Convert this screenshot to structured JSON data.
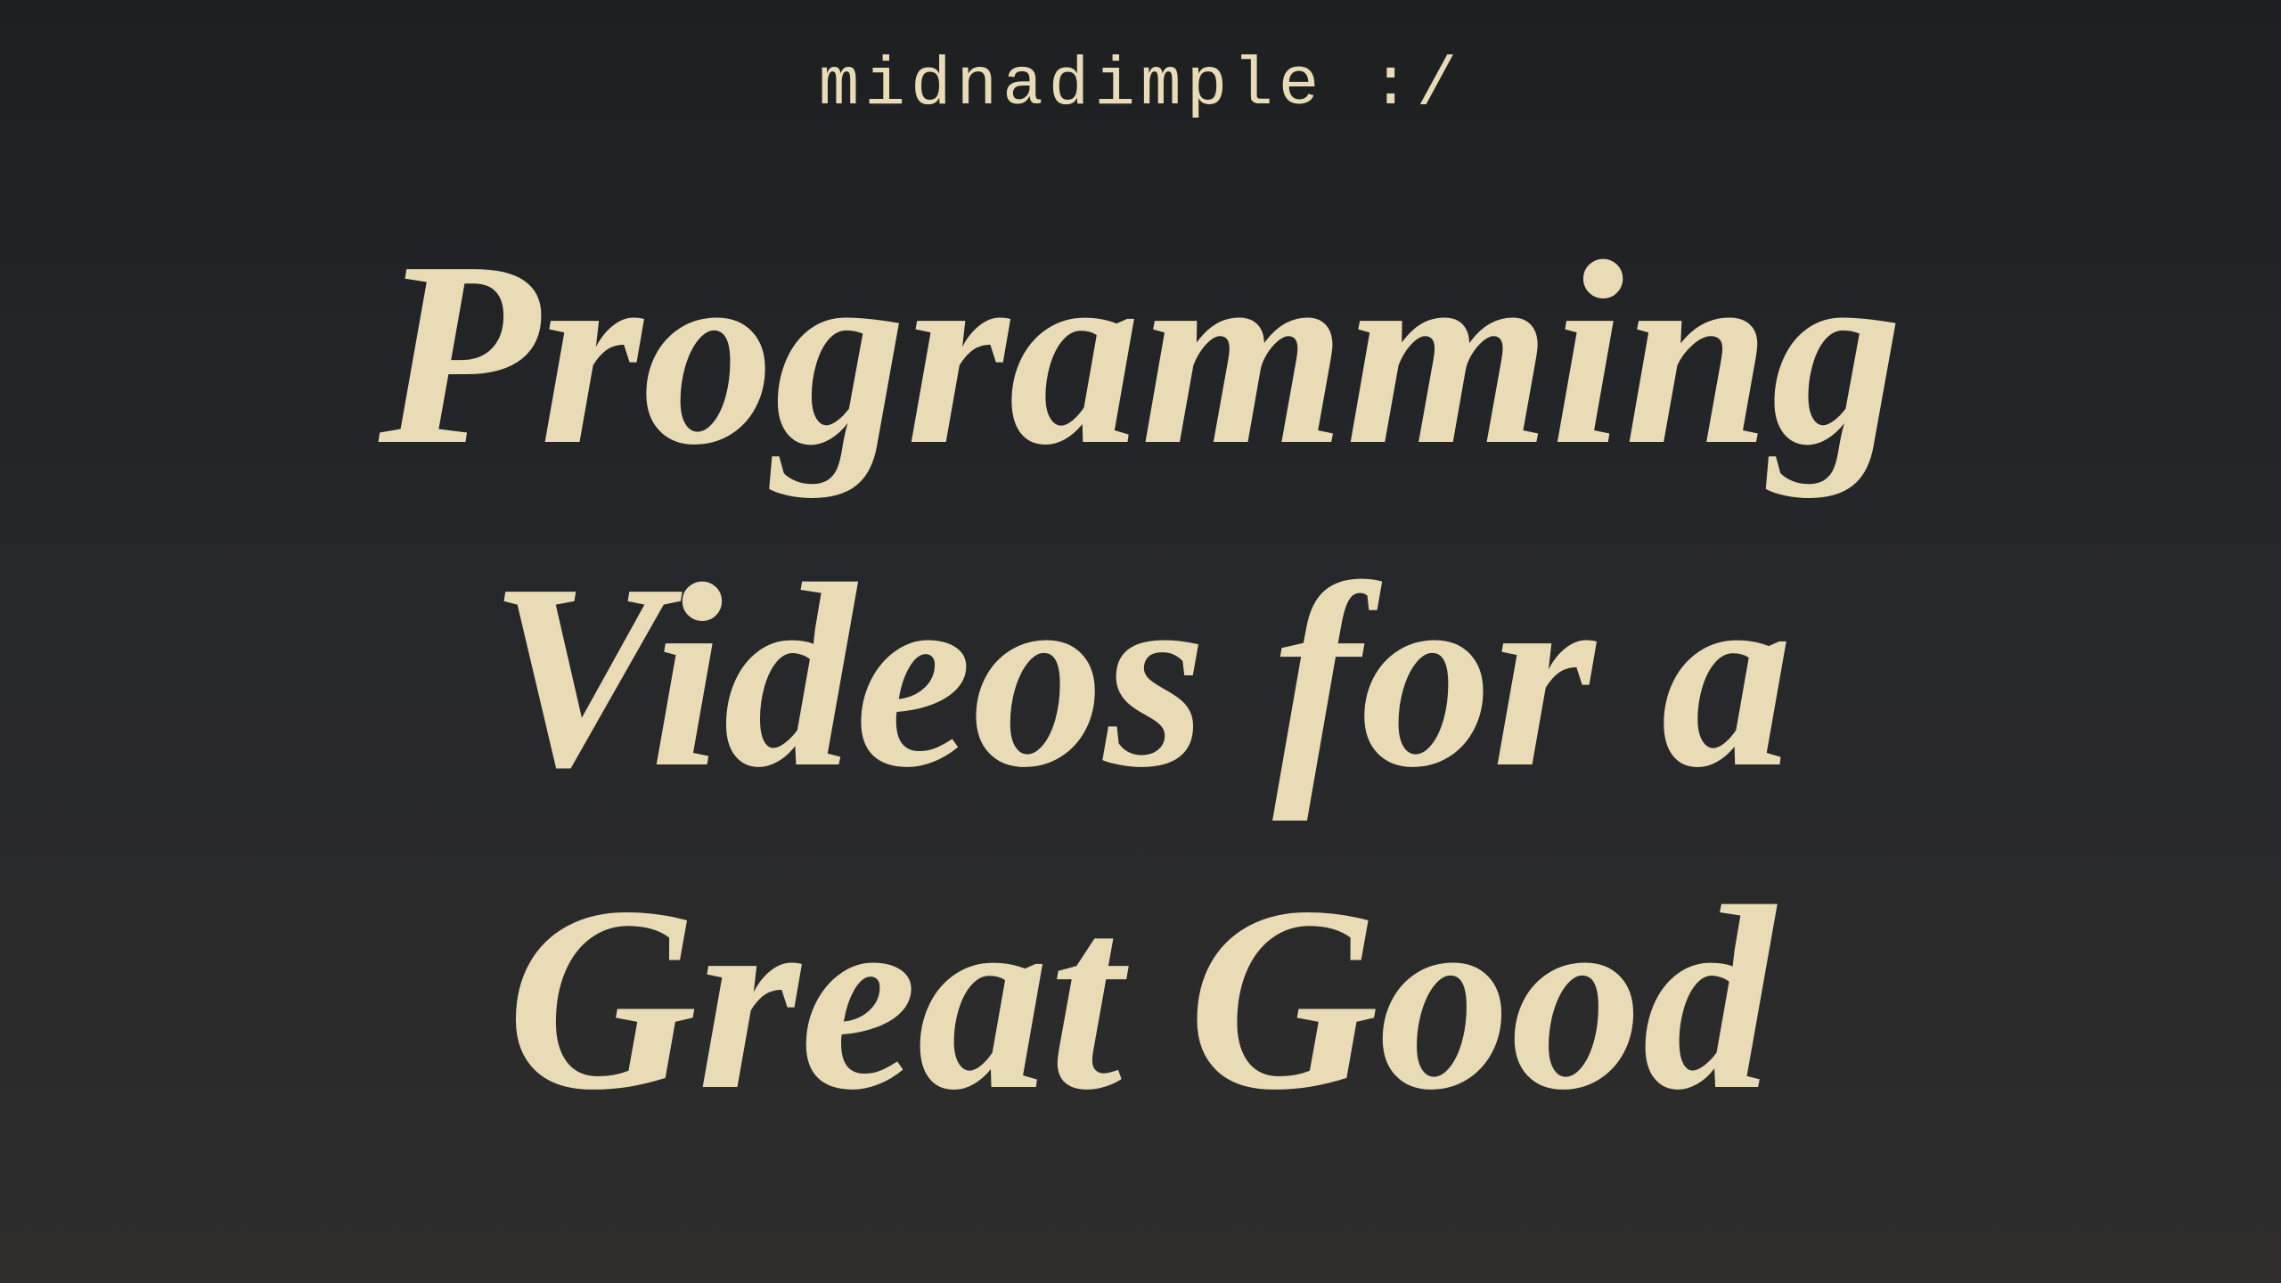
{
  "header": {
    "site_name": "midnadimple :/"
  },
  "hero": {
    "lines": [
      "Programming",
      "Videos for a",
      "Great Good"
    ]
  },
  "colors": {
    "background_top": "#1d1f21",
    "background_bottom": "#2e2d2c",
    "text": "#e8dbb5"
  }
}
